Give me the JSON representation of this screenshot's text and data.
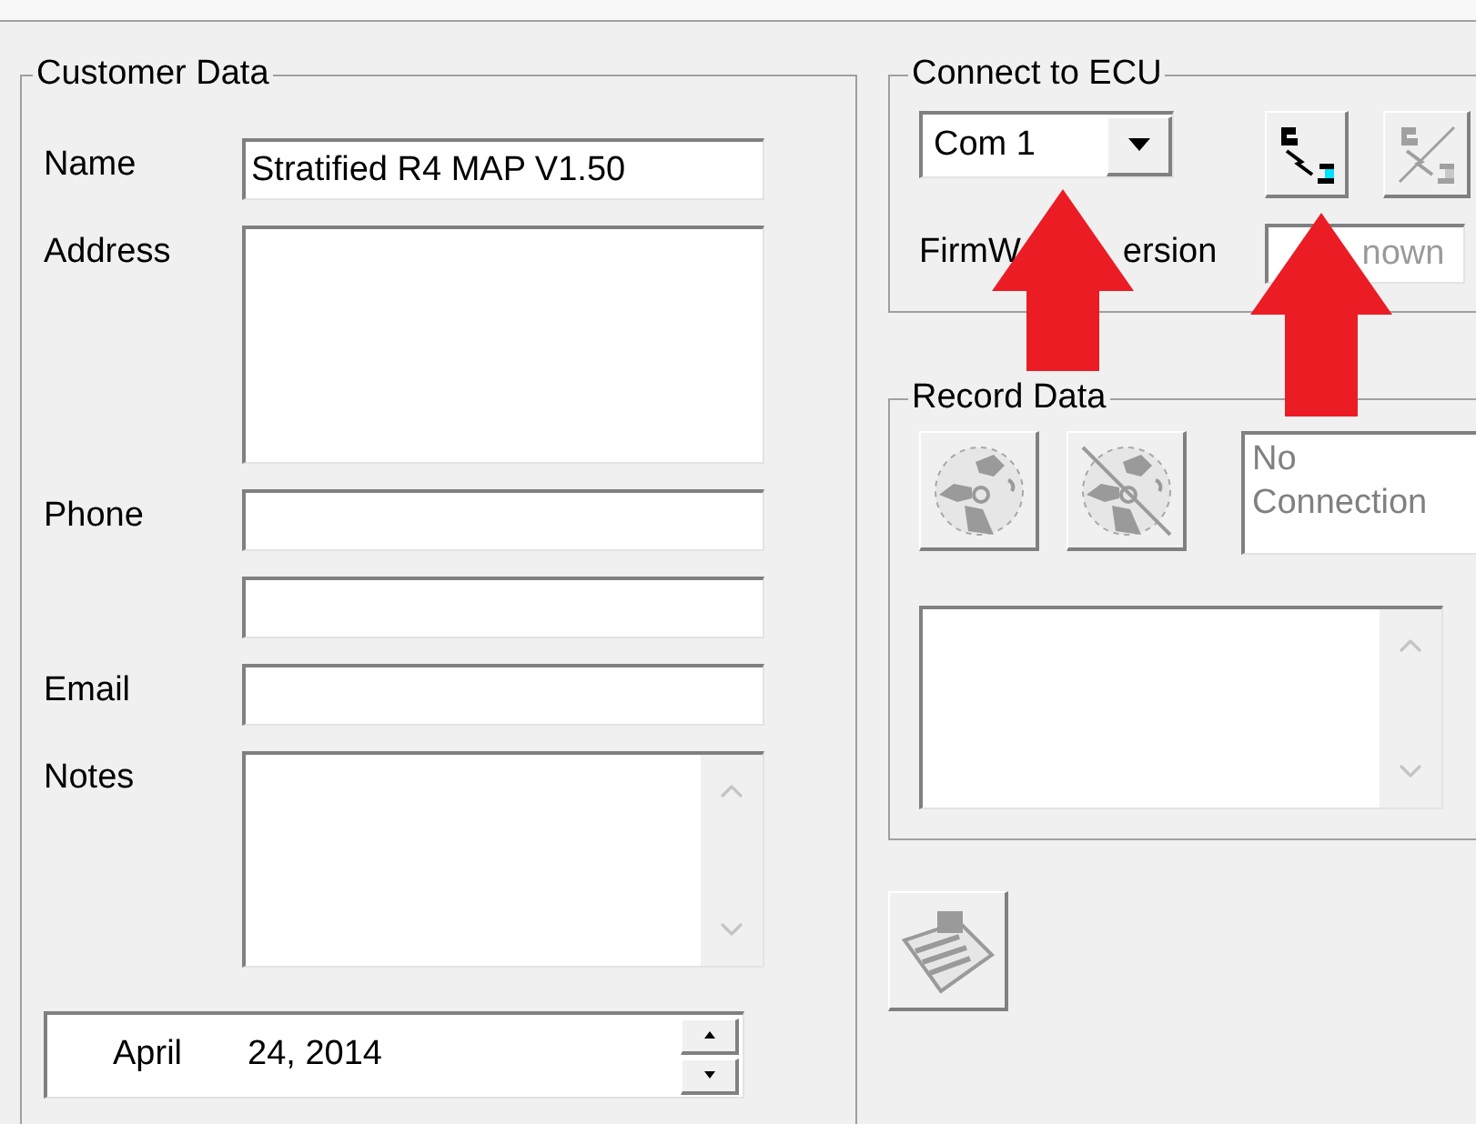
{
  "customer_data": {
    "title": "Customer Data",
    "fields": [
      {
        "label": "Name",
        "value": "Stratified R4 MAP V1.50",
        "kind": "line"
      },
      {
        "label": "Address",
        "kind": "area"
      },
      {
        "label": "Phone",
        "kind": "line"
      },
      {
        "kind": "line"
      },
      {
        "label": "Email",
        "kind": "line"
      },
      {
        "label": "Notes",
        "kind": "scroll_area"
      }
    ],
    "date": {
      "month": "April",
      "day_year": "24, 2014"
    }
  },
  "connect": {
    "title": "Connect to ECU",
    "port": "Com 1",
    "connect_button": {
      "disabled": false
    },
    "disconnect_button": {
      "disabled": true
    },
    "firmware_label_parts": [
      "FirmW",
      "ersion"
    ],
    "firmware_value": "nown"
  },
  "record": {
    "title": "Record Data",
    "record_button": {
      "disabled": true
    },
    "stop_button": {
      "disabled": true
    },
    "status": "No Connection"
  },
  "log_button": {
    "disabled": true
  }
}
